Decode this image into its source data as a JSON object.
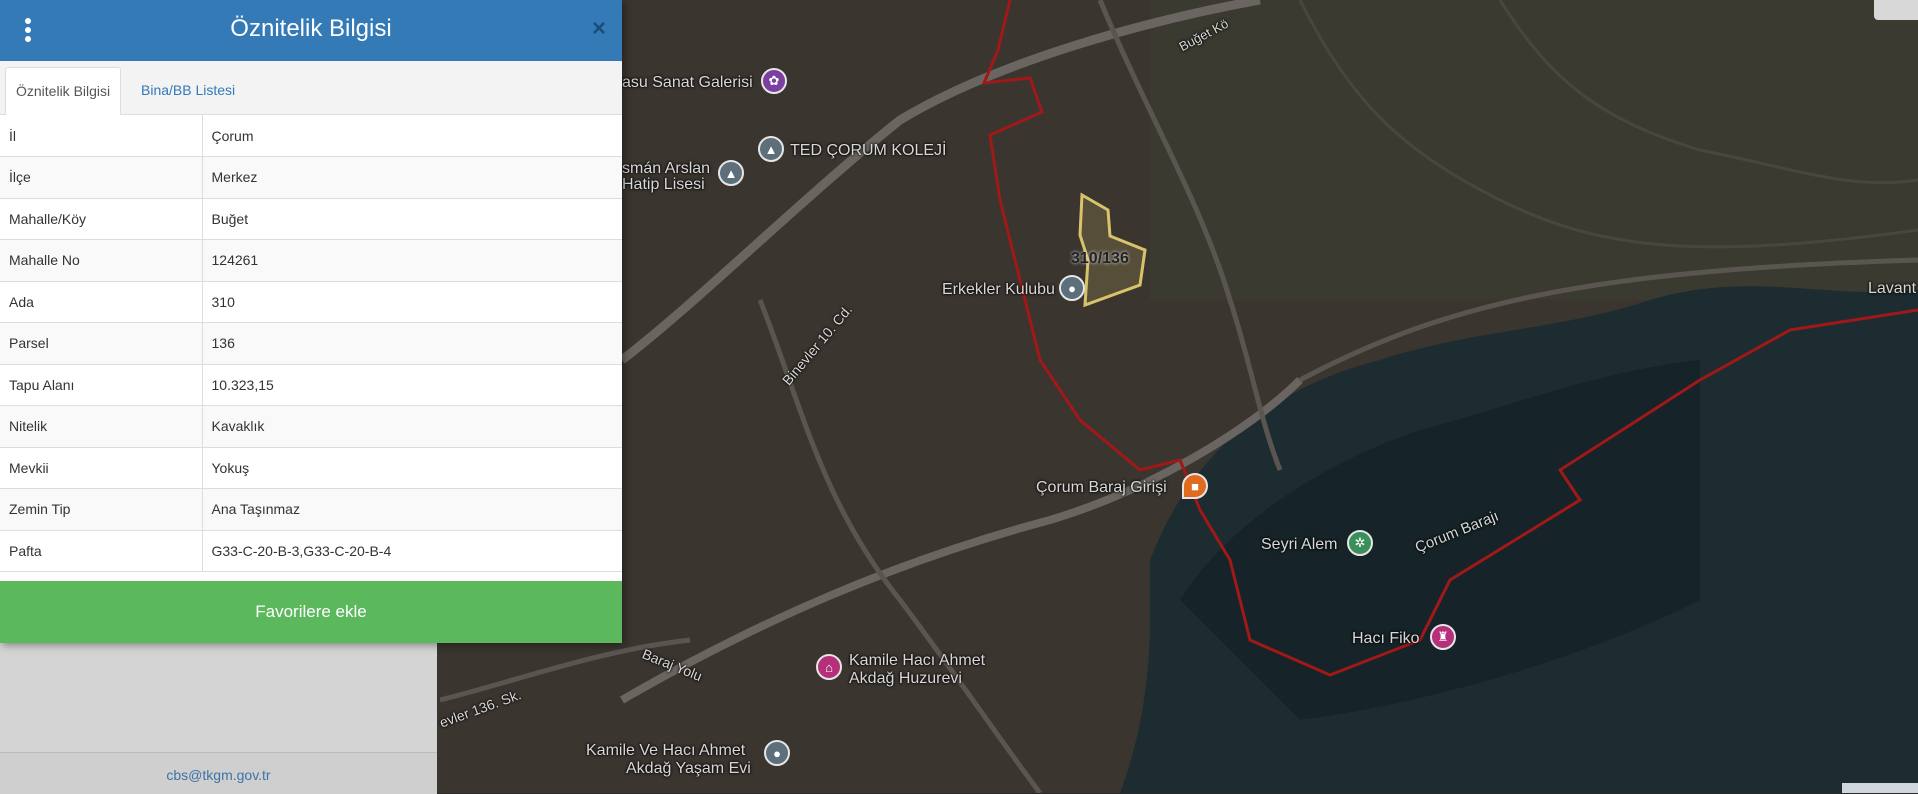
{
  "panel": {
    "title": "Öznitelik Bilgisi",
    "close_label": "×",
    "tabs": [
      {
        "label": "Öznitelik Bilgisi",
        "active": true
      },
      {
        "label": "Bina/BB Listesi",
        "active": false
      }
    ],
    "rows": [
      {
        "key": "İl",
        "value": "Çorum"
      },
      {
        "key": "İlçe",
        "value": "Merkez"
      },
      {
        "key": "Mahalle/Köy",
        "value": "Buğet"
      },
      {
        "key": "Mahalle No",
        "value": "124261"
      },
      {
        "key": "Ada",
        "value": "310"
      },
      {
        "key": "Parsel",
        "value": "136"
      },
      {
        "key": "Tapu Alanı",
        "value": "10.323,15"
      },
      {
        "key": "Nitelik",
        "value": "Kavaklık"
      },
      {
        "key": "Mevkii",
        "value": "Yokuş"
      },
      {
        "key": "Zemin Tip",
        "value": "Ana Taşınmaz"
      },
      {
        "key": "Pafta",
        "value": "G33-C-20-B-3,G33-C-20-B-4"
      }
    ],
    "favorite_label": "Favorilere ekle"
  },
  "footer": {
    "email": "cbs@tkgm.gov.tr"
  },
  "map": {
    "labels": {
      "sanat": "asu Sanat Galerisi",
      "kolej": "TED ÇORUM KOLEJİ",
      "lise1": "smán Arslan",
      "lise2": "Hatip Lisesi",
      "parcel": "310/136",
      "erkekler": "Erkekler Kulubu",
      "binevler": "Binevler 10. Cd.",
      "baraj_girisi": "Çorum Baraj Girişi",
      "seyri": "Seyri Alem",
      "corum_baraji": "Çorum Barajı",
      "haci_fiko": "Hacı Fiko",
      "kamile1": "Kamile Hacı Ahmet",
      "kamile2": "Akdağ Huzurevi",
      "kamile3": "Kamile Ve Hacı Ahmet",
      "kamile4": "Akdağ Yaşam Evi",
      "baraj_yolu": "Baraj Yolu",
      "sk": "evler 136. Sk.",
      "buget": "Buğet Kö",
      "lavant": "Lavant"
    }
  },
  "colors": {
    "header": "#337ab7",
    "favorite": "#5cb85c",
    "boundary": "#a01818",
    "parcel": "#d9c36a"
  }
}
